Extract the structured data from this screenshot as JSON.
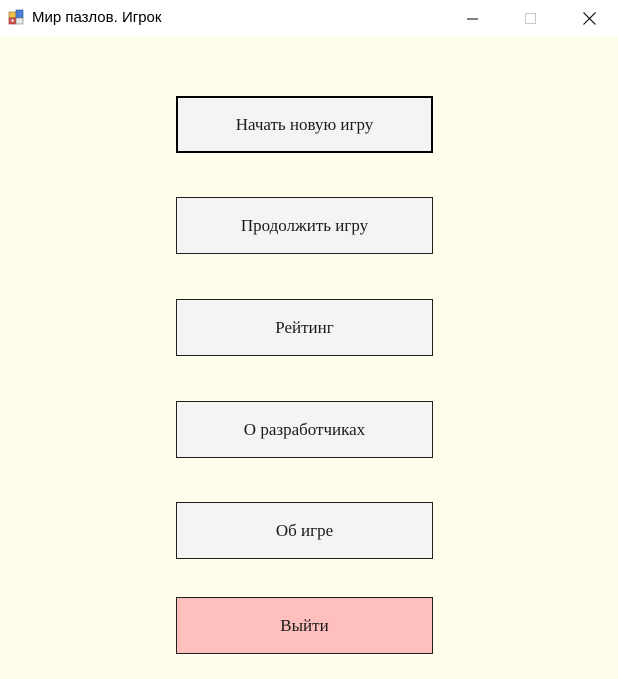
{
  "window": {
    "title": "Мир пазлов. Игрок",
    "icon": "app-puzzle-icon",
    "controls": {
      "minimize_icon": "minimize-icon",
      "maximize_icon": "maximize-icon",
      "close_icon": "close-icon"
    }
  },
  "colors": {
    "client_background": "#fffeec",
    "button_background": "#f4f4f4",
    "exit_button_background": "#ffbfbd"
  },
  "menu": {
    "new_game": "Начать новую игру",
    "continue_game": "Продолжить игру",
    "rating": "Рейтинг",
    "developers": "О разработчиках",
    "about_game": "Об игре",
    "exit": "Выйти"
  }
}
